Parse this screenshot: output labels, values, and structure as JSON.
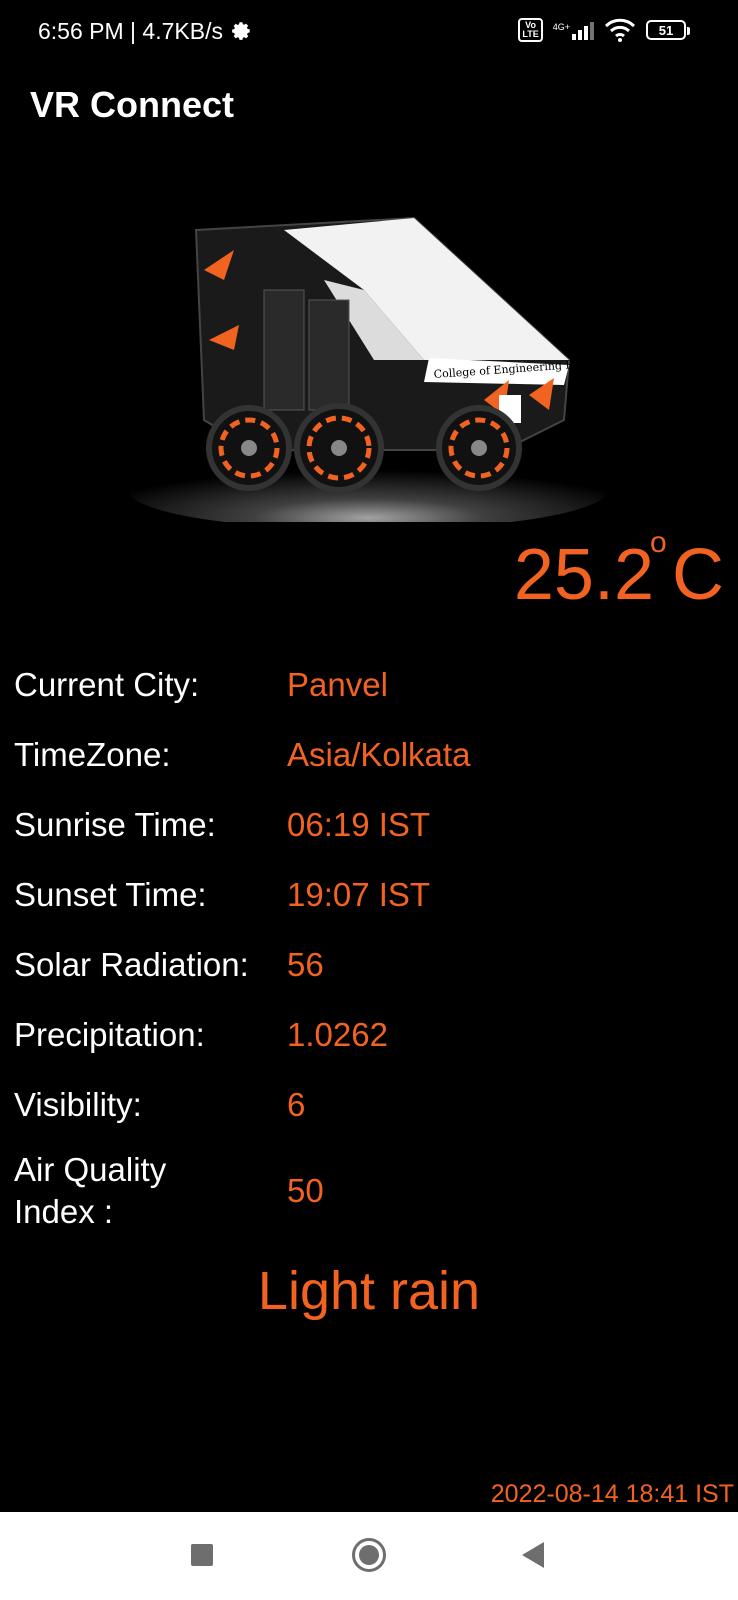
{
  "status_bar": {
    "time_speed": "6:56 PM | 4.7KB/s",
    "volte": "Vo LTE",
    "network": "4G+",
    "battery": "51"
  },
  "app": {
    "title": "VR Connect"
  },
  "weather": {
    "temperature": "25.2",
    "degree_symbol": "o",
    "unit": "C",
    "rows": [
      {
        "label": "Current City:",
        "value": "Panvel"
      },
      {
        "label": "TimeZone:",
        "value": "Asia/Kolkata"
      },
      {
        "label": "Sunrise Time:",
        "value": "06:19 IST"
      },
      {
        "label": "Sunset Time:",
        "value": "19:07 IST"
      },
      {
        "label": "Solar Radiation:",
        "value": "56"
      },
      {
        "label": "Precipitation:",
        "value": "1.0262"
      },
      {
        "label": "Visibility:",
        "value": "6"
      },
      {
        "label": "Air Quality Index :",
        "value": "50"
      }
    ],
    "condition": "Light rain",
    "timestamp": "2022-08-14 18:41 IST"
  },
  "vehicle_image": {
    "caption": "College of Engineering Pune"
  },
  "colors": {
    "accent": "#f26322",
    "background": "#000000"
  }
}
